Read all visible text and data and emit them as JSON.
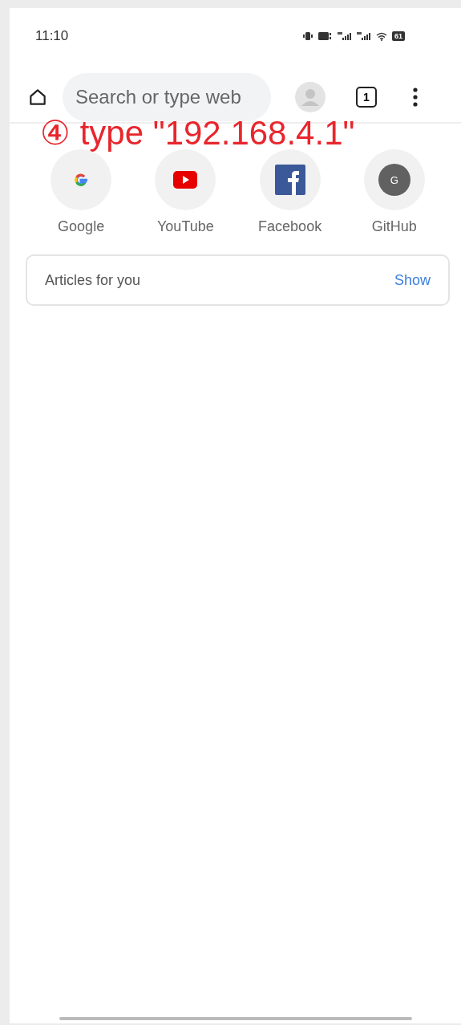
{
  "status_bar": {
    "time": "11:10",
    "battery": "61"
  },
  "toolbar": {
    "search": {
      "placeholder": "Search or type web"
    },
    "tab_count": "1"
  },
  "annotation": {
    "step": "④",
    "text": "type \"192.168.4.1\""
  },
  "shortcuts": [
    {
      "kind": "google",
      "label": "Google"
    },
    {
      "kind": "youtube",
      "label": "YouTube"
    },
    {
      "kind": "facebook",
      "label": "Facebook"
    },
    {
      "kind": "letter",
      "label": "GitHub",
      "letter": "G"
    }
  ],
  "articles": {
    "title": "Articles for you",
    "action": "Show"
  }
}
